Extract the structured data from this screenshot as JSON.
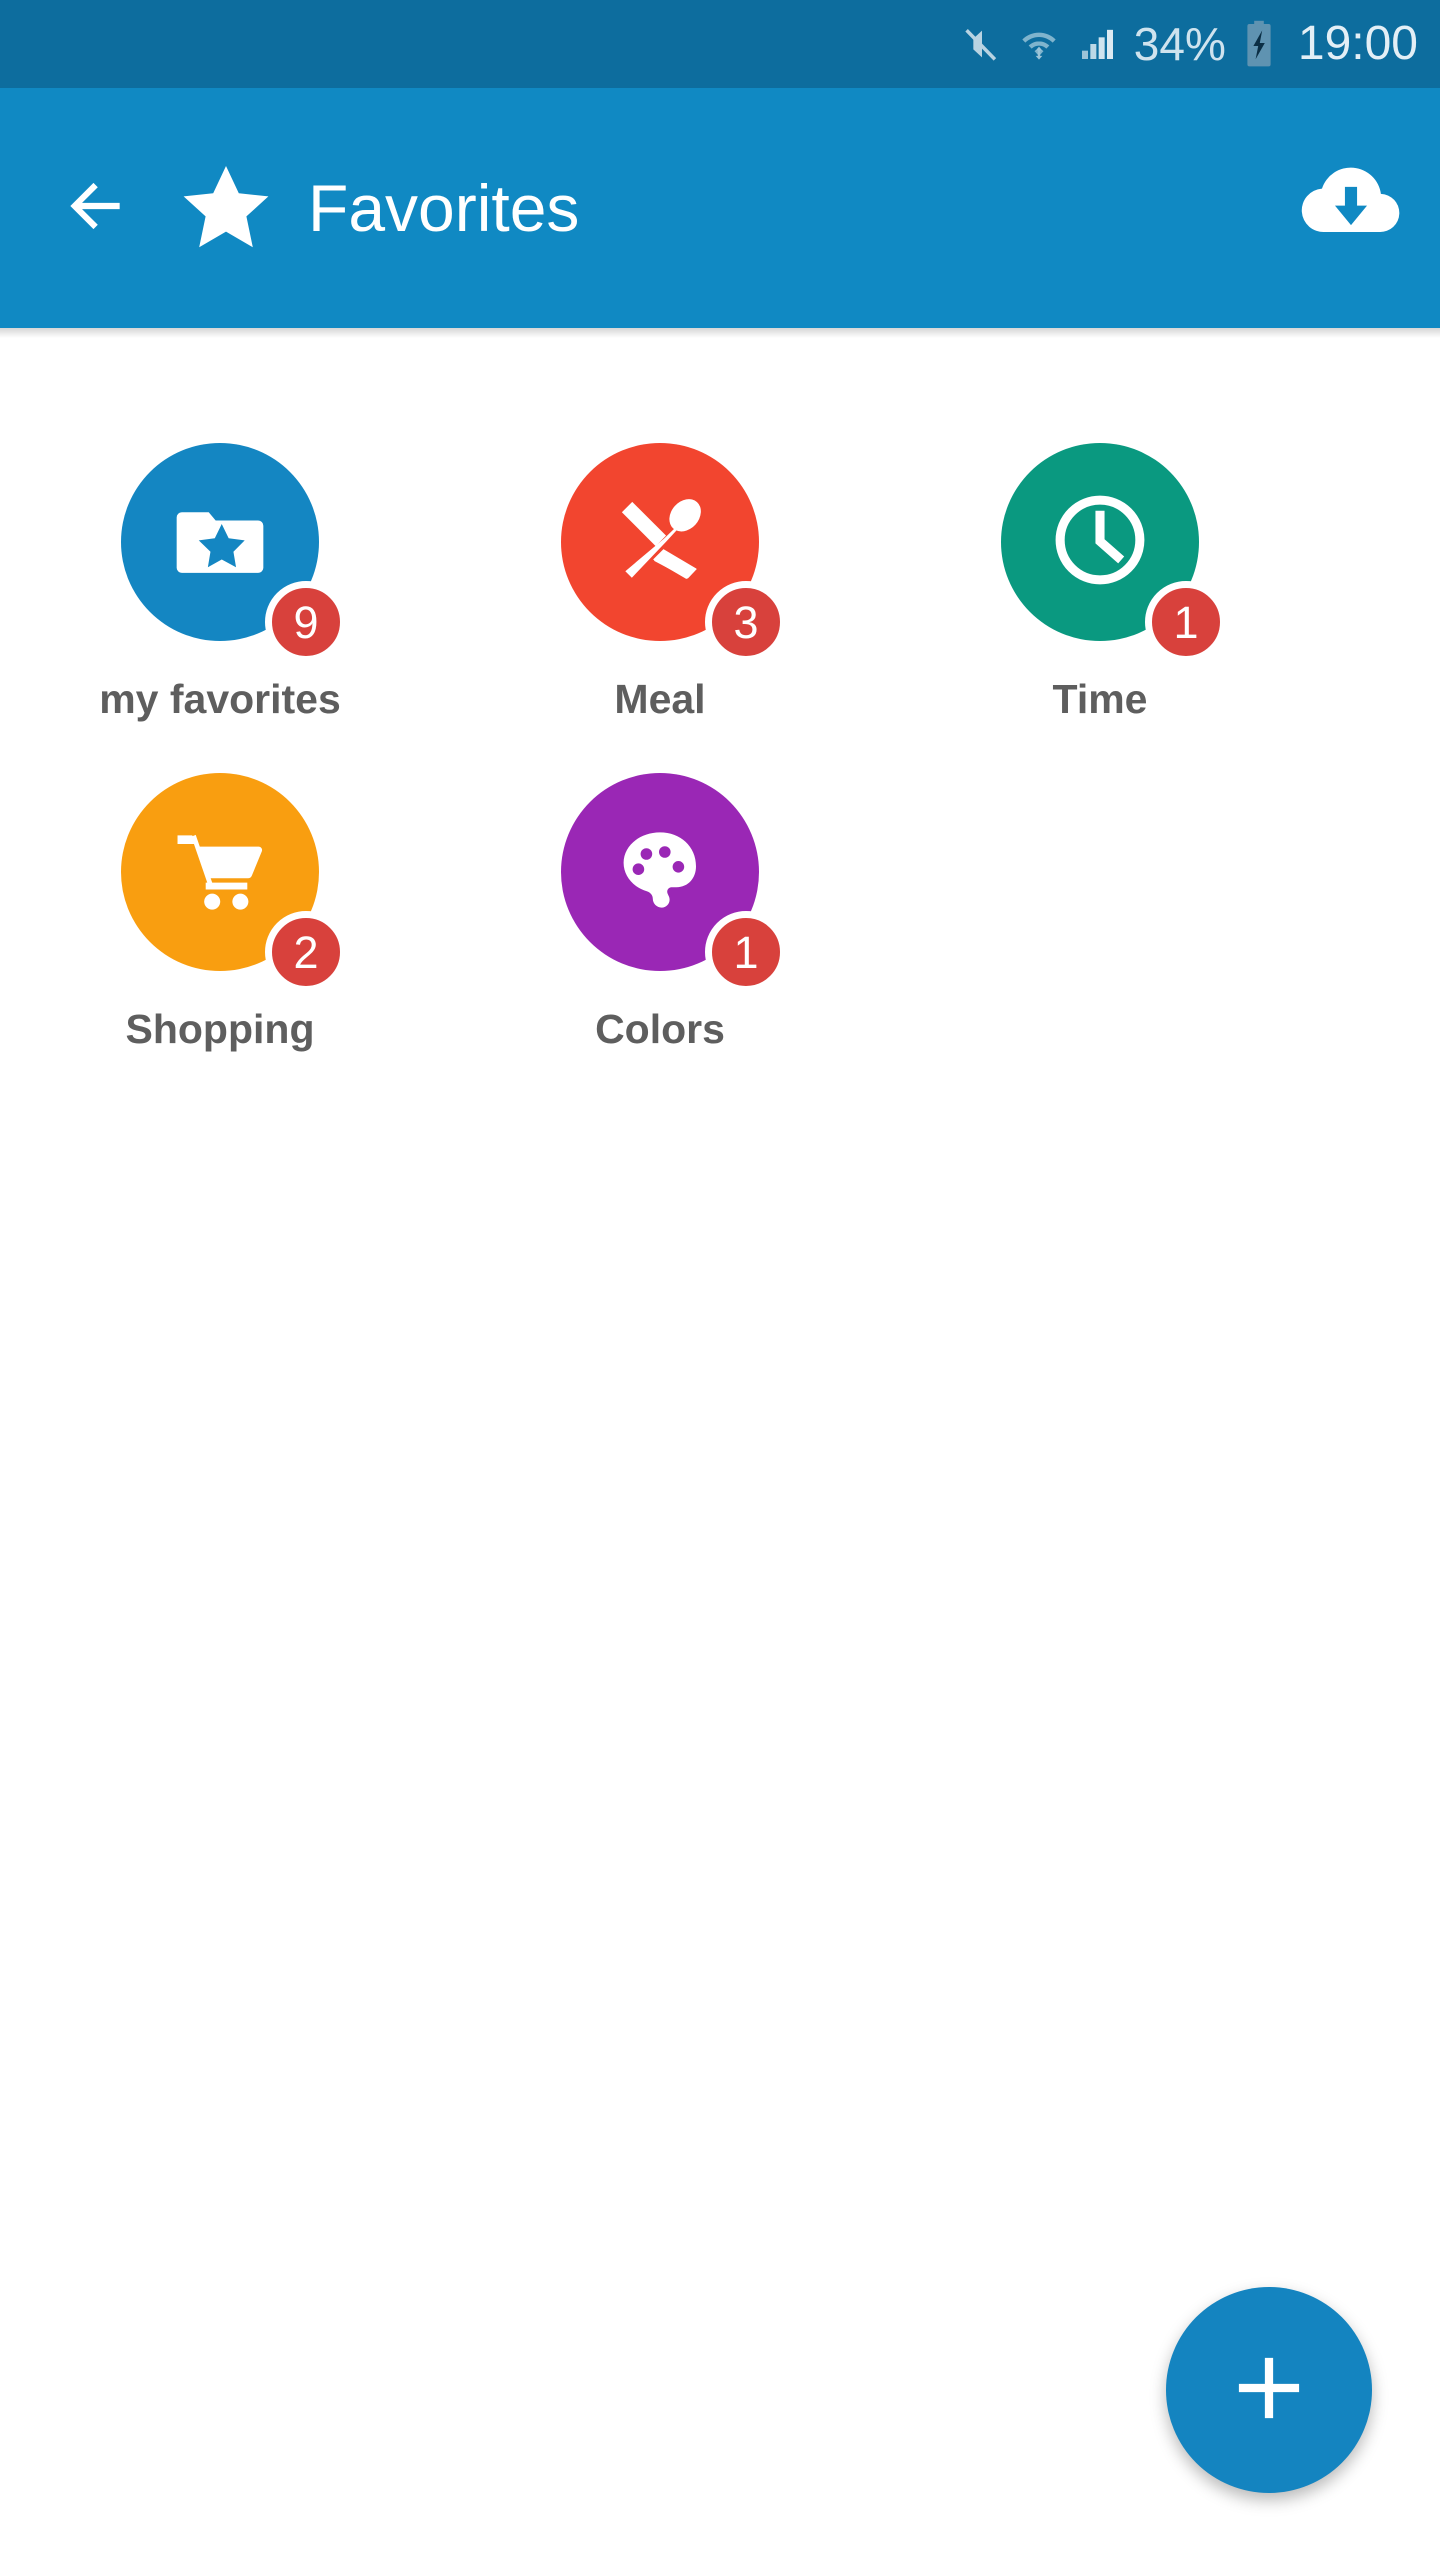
{
  "status_bar": {
    "background": "#0d6d9e",
    "mute_icon": "mute-icon",
    "wifi_icon": "wifi-icon",
    "signal_icon": "signal-bars-icon",
    "battery_percent": "34%",
    "battery_icon": "battery-charging-icon",
    "clock": "19:00"
  },
  "app_bar": {
    "background": "#1089c3",
    "back_icon": "back-arrow-icon",
    "star_icon": "star-icon",
    "title": "Favorites",
    "download_icon": "cloud-download-icon"
  },
  "tiles": [
    {
      "id": "my-favorites",
      "label": "my favorites",
      "badge": "9",
      "color": "#1486c2",
      "icon": "folder-star-icon"
    },
    {
      "id": "meal",
      "label": "Meal",
      "badge": "3",
      "color": "#f2452f",
      "icon": "knife-spoon-icon"
    },
    {
      "id": "time",
      "label": "Time",
      "badge": "1",
      "color": "#0a9980",
      "icon": "clock-icon"
    },
    {
      "id": "shopping",
      "label": "Shopping",
      "badge": "2",
      "color": "#f99e10",
      "icon": "shopping-cart-icon"
    },
    {
      "id": "colors",
      "label": "Colors",
      "badge": "1",
      "color": "#9a27b5",
      "icon": "palette-icon"
    }
  ],
  "fab": {
    "icon": "plus-icon",
    "color": "#1484c0"
  },
  "badge_color": "#d8413c",
  "label_color": "#5e5e5e"
}
